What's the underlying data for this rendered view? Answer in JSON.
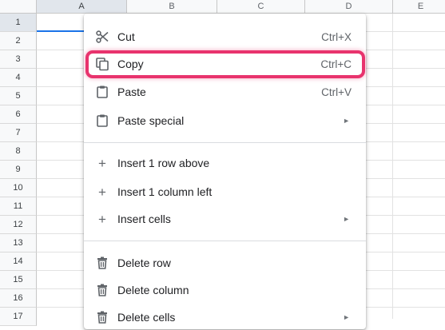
{
  "sheet": {
    "columns": [
      "A",
      "B",
      "C",
      "D",
      "E"
    ],
    "rows": [
      "1",
      "2",
      "3",
      "4",
      "5",
      "6",
      "7",
      "8",
      "9",
      "10",
      "11",
      "12",
      "13",
      "14",
      "15",
      "16",
      "17"
    ]
  },
  "menu": {
    "cut": {
      "label": "Cut",
      "shortcut": "Ctrl+X",
      "icon": "scissors-icon"
    },
    "copy": {
      "label": "Copy",
      "shortcut": "Ctrl+C",
      "icon": "copy-icon"
    },
    "paste": {
      "label": "Paste",
      "shortcut": "Ctrl+V",
      "icon": "clipboard-icon"
    },
    "paste_special": {
      "label": "Paste special",
      "icon": "clipboard-icon",
      "submenu": true
    },
    "insert_row": {
      "label": "Insert 1 row above",
      "icon": "plus-icon"
    },
    "insert_col": {
      "label": "Insert 1 column left",
      "icon": "plus-icon"
    },
    "insert_cells": {
      "label": "Insert cells",
      "icon": "plus-icon",
      "submenu": true
    },
    "delete_row": {
      "label": "Delete row",
      "icon": "trash-icon"
    },
    "delete_col": {
      "label": "Delete column",
      "icon": "trash-icon"
    },
    "delete_cells": {
      "label": "Delete cells",
      "icon": "trash-icon",
      "submenu": true
    }
  },
  "colors": {
    "highlight": "#e8336d",
    "selection": "#1a73e8"
  }
}
